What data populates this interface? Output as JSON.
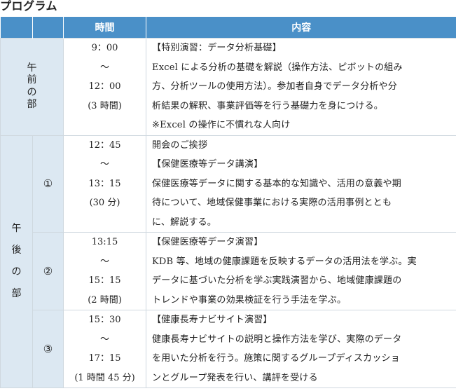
{
  "page_title": "プログラム",
  "table": {
    "header": {
      "blank1": "",
      "blank2": "",
      "time": "時間",
      "content": "内容"
    },
    "morning": {
      "label_chars": [
        "午",
        "前",
        "の",
        "部"
      ],
      "time_lines": [
        "9：00",
        "～",
        "12：00",
        "(3 時間)"
      ],
      "content_lines": [
        "【特別演習：データ分析基礎】",
        "Excel による分析の基礎を解説（操作方法、ピボットの組み",
        "方、分析ツールの使用方法）。参加者自身でデータ分析や分",
        "析結果の解釈、事業評価等を行う基礎力を身につける。",
        "※Excel の操作に不慣れな人向け"
      ]
    },
    "afternoon": {
      "label_chars": [
        "午",
        "後",
        "の",
        "部"
      ],
      "sessions": [
        {
          "number": "①",
          "time_lines": [
            "12：45",
            "～",
            "13：15",
            "(30 分)"
          ],
          "content_lines": [
            "開会のご挨拶",
            "【保健医療等データ講演】",
            "保健医療等データに関する基本的な知識や、活用の意義や期",
            "待について、地域保健事業における実際の活用事例ととも",
            "に、解説する。"
          ]
        },
        {
          "number": "②",
          "time_lines": [
            "13:15",
            "～",
            "15：15",
            "(2 時間)"
          ],
          "content_lines": [
            "【保健医療等データ演習】",
            "KDB 等、地域の健康課題を反映するデータの活用法を学ぶ。実",
            "データに基づいた分析を学ぶ実践演習から、地域健康課題の",
            "トレンドや事業の効果検証を行う手法を学ぶ。"
          ]
        },
        {
          "number": "③",
          "time_lines": [
            "15：30",
            "～",
            "17：15",
            "(1 時間 45 分)"
          ],
          "content_lines": [
            "【健康長寿ナビサイト演習】",
            "健康長寿ナビサイトの説明と操作方法を学び、実際のデータ",
            "を用いた分析を行う。施策に関するグループディスカッショ",
            "ンとグループ発表を行い、講評を受ける"
          ]
        }
      ]
    }
  }
}
